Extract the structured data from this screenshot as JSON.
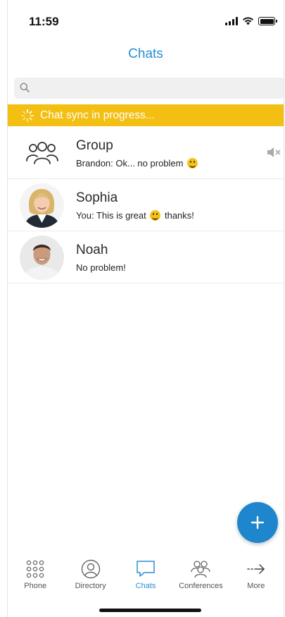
{
  "status_bar": {
    "time": "11:59"
  },
  "header": {
    "title": "Chats"
  },
  "search": {
    "placeholder": "",
    "value": ""
  },
  "sync_banner": {
    "text": "Chat sync in progress..."
  },
  "chats": [
    {
      "name": "Group",
      "preview": "Brandon: Ok... no problem",
      "emoji": "smile",
      "muted": true,
      "avatar": "group-icon"
    },
    {
      "name": "Sophia",
      "preview": "You: This is great",
      "preview_suffix": "thanks!",
      "emoji": "smile",
      "avatar": "photo"
    },
    {
      "name": "Noah",
      "preview": "No problem!",
      "avatar": "photo"
    }
  ],
  "tabs": [
    {
      "label": "Phone",
      "icon": "dialpad-icon",
      "active": false
    },
    {
      "label": "Directory",
      "icon": "person-icon",
      "active": false
    },
    {
      "label": "Chats",
      "icon": "chat-bubble-icon",
      "active": true
    },
    {
      "label": "Conferences",
      "icon": "conference-icon",
      "active": false
    },
    {
      "label": "More",
      "icon": "arrow-more-icon",
      "active": false
    }
  ],
  "colors": {
    "accent": "#2a8fd4",
    "banner": "#f2bf12",
    "fab": "#1e86cc"
  }
}
